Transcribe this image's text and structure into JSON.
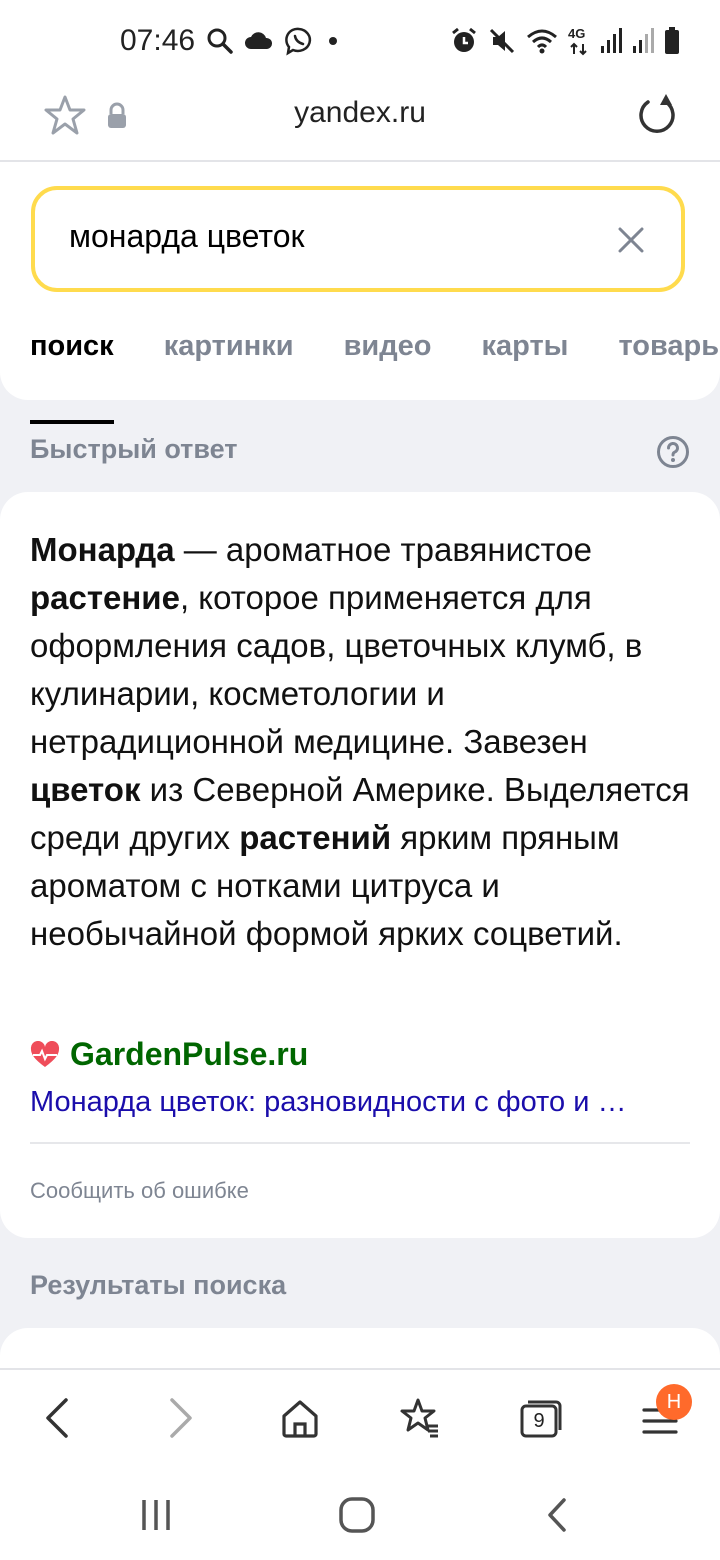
{
  "status_bar": {
    "time": "07:46",
    "icons_left": [
      "search-icon",
      "cloud-icon",
      "viber-icon",
      "dot-icon"
    ],
    "icons_right": [
      "alarm-icon",
      "mute-icon",
      "wifi-icon",
      "4g-icon",
      "signal-icon",
      "signal-icon",
      "battery-icon"
    ],
    "network_label": "4G"
  },
  "browser": {
    "url": "yandex.ru",
    "icons": [
      "star-icon",
      "lock-icon",
      "reload-icon"
    ]
  },
  "search": {
    "query": "монарда цветок",
    "tabs": [
      {
        "label": "поиск",
        "active": true
      },
      {
        "label": "картинки",
        "active": false
      },
      {
        "label": "видео",
        "active": false
      },
      {
        "label": "карты",
        "active": false
      },
      {
        "label": "товары",
        "active": false
      }
    ]
  },
  "quick_answer": {
    "section_title": "Быстрый ответ",
    "parts": [
      {
        "text": "Монарда",
        "bold": true
      },
      {
        "text": " — ароматное травянистое ",
        "bold": false
      },
      {
        "text": "растение",
        "bold": true
      },
      {
        "text": ", которое применяется для оформления садов, цветочных клумб, в кулинарии, косметологии и нетрадиционной медицине. Завезен ",
        "bold": false
      },
      {
        "text": "цветок",
        "bold": true
      },
      {
        "text": " из Северной Америке. Выделяется среди других ",
        "bold": false
      },
      {
        "text": "растений",
        "bold": true
      },
      {
        "text": " ярким пряным ароматом с нотками цитруса и необычайной формой ярких соцветий.",
        "bold": false
      }
    ],
    "source_name": "GardenPulse.ru",
    "source_title": "Монарда цветок: разновидности с фото и …",
    "report_label": "Сообщить об ошибке"
  },
  "results": {
    "section_title": "Результаты поиска"
  },
  "bottom_nav": {
    "tabs_count": "9",
    "badge": "Н"
  },
  "colors": {
    "search_border": "#ffdb4d",
    "source_green": "#006600",
    "link_blue": "#1a0dab",
    "badge_orange": "#ff6a2b",
    "background": "#f0f1f5"
  }
}
